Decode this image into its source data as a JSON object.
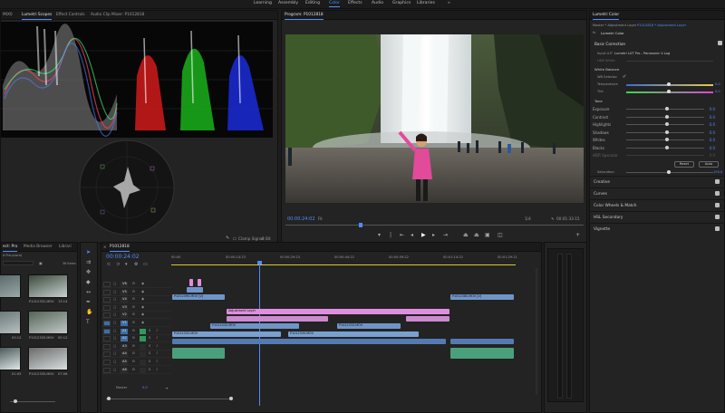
{
  "workspaces": [
    "Learning",
    "Assembly",
    "Editing",
    "Color",
    "Effects",
    "Audio",
    "Graphics",
    "Libraries"
  ],
  "active_workspace": "Color",
  "more_icon": "»",
  "scopes_panel": {
    "tabs": [
      "MIX0",
      "Lumetri Scopes",
      "Effect Controls",
      "Audio Clip Mixer: P1012818"
    ],
    "active_tab": "Lumetri Scopes",
    "clamp_label": "Clamp Signal",
    "bit_label": "8 Bit"
  },
  "program_monitor": {
    "title": "Program: P1012818",
    "timecode": "00:00:24:02",
    "fit": "Fit",
    "quality": "1/4",
    "duration": "00:01:33:15"
  },
  "project_panel": {
    "tabs": [
      "ect: Pro",
      "Media Browser",
      "Librari"
    ],
    "subtitle": "d Pro.prproj",
    "count": "36 Items",
    "thumbs": [
      {
        "label": "",
        "dur": ""
      },
      {
        "label": "P1012331.MOV",
        "dur": "13:14"
      },
      {
        "label": "",
        "dur": "03:12"
      },
      {
        "label": "P1012333.MOV",
        "dur": "05:12"
      },
      {
        "label": "",
        "dur": "01:05"
      },
      {
        "label": "P1012335.MOV",
        "dur": "07:06"
      }
    ]
  },
  "timeline": {
    "title": "P1012818",
    "timecode": "00:00:24:02",
    "ruler": [
      "00:00",
      "00:00:14:23",
      "00:00:29:23",
      "00:00:44:22",
      "00:00:59:22",
      "00:01:14:22",
      "00:01:29:21"
    ],
    "tracks": [
      "V6",
      "V5",
      "V4",
      "V3",
      "V2",
      "V1",
      "A1",
      "A2",
      "A3",
      "A4",
      "A5",
      "A6"
    ],
    "master_label": "Master",
    "master_value": "0.0",
    "clips": {
      "v4_a": "P1012390.MOV [V]",
      "v4_b": "P1012385.MOV [V]",
      "adj": "Adjustment Layer",
      "v2_a": "P1012332.MOV",
      "v2_b": "P1012333.MOV",
      "v1_a": "P1012332.MOV",
      "v1_b": "P1012335.MOV"
    }
  },
  "lumetri": {
    "panel_title": "Lumetri Color",
    "breadcrumb_left": "Master * Adjustment Layer",
    "breadcrumb_right": "P1012818 * Adjustment Layer",
    "effect_name": "Lumetri Color",
    "basic_correction": "Basic Correction",
    "input_lut_label": "Input LUT",
    "input_lut_value": "Lumetri LUT Pro - Panasonic V-Log",
    "hdr_white_label": "HDR White",
    "white_balance": "White Balance",
    "wb_selector": "WB Selector",
    "temperature": {
      "label": "Temperature",
      "value": "0.0"
    },
    "tint": {
      "label": "Tint",
      "value": "0.0"
    },
    "tone": "Tone",
    "tone_rows": [
      {
        "label": "Exposure",
        "value": "0.0"
      },
      {
        "label": "Contrast",
        "value": "0.0"
      },
      {
        "label": "Highlights",
        "value": "0.0"
      },
      {
        "label": "Shadows",
        "value": "0.0"
      },
      {
        "label": "Whites",
        "value": "0.0"
      },
      {
        "label": "Blacks",
        "value": "0.0"
      },
      {
        "label": "HDR Specular",
        "value": "0.0"
      }
    ],
    "reset_button": "Reset",
    "auto_button": "Auto",
    "saturation": {
      "label": "Saturation",
      "value": "100.0"
    },
    "sections": [
      "Creative",
      "Curves",
      "Color Wheels & Match",
      "HSL Secondary",
      "Vignette"
    ]
  },
  "colors": {
    "accent": "#4f8cff",
    "adjustment_clip": "#e08ee0",
    "video_clip": "#6f95c8",
    "audio_clip": "#4aa07a"
  }
}
